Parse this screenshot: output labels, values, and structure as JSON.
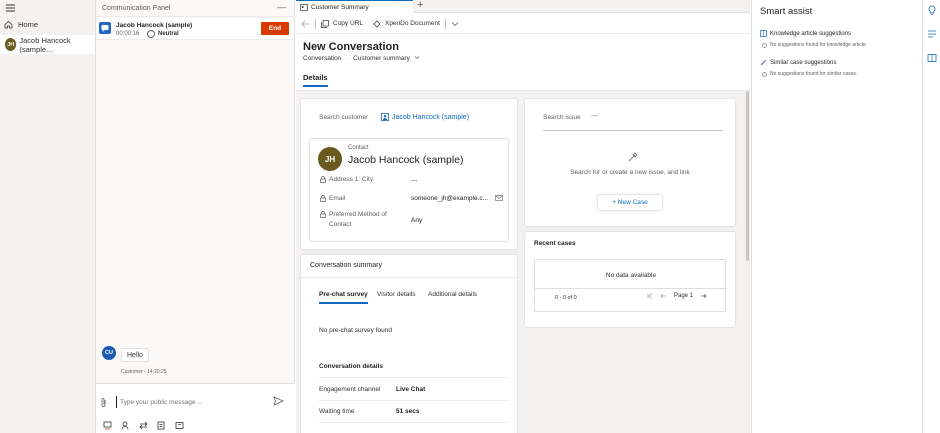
{
  "nav": {
    "home_label": "Home",
    "session_initials": "JH",
    "session_label": "Jacob Hancock (sample..."
  },
  "comm_panel": {
    "title": "Communication Panel",
    "minimize_glyph": "—",
    "session": {
      "name": "Jacob Hancock (sample)",
      "timer": "00:00:16",
      "sentiment": "Neutral",
      "end_label": "End"
    },
    "message": {
      "sender_initials": "CU",
      "text": "Hello",
      "meta": "Customer - 14:20:25"
    },
    "compose_placeholder": "Type your public message ..."
  },
  "tabs": {
    "active_tab": "Customer Summary",
    "add_glyph": "+"
  },
  "commands": {
    "copy_url": "Copy URL",
    "xperido": "XperiDo Document"
  },
  "page": {
    "title": "New Conversation",
    "breadcrumb_entity": "Conversation",
    "breadcrumb_separator": "·",
    "breadcrumb_form": "Customer summary",
    "details_tab": "Details"
  },
  "customer": {
    "search_label": "Search customer",
    "selected": "Jacob Hancock (sample)",
    "initials": "JH",
    "type": "Contact",
    "name": "Jacob Hancock (sample)",
    "fields": [
      {
        "label": "Address 1: City",
        "value": "---"
      },
      {
        "label": "Email",
        "value": "someone_jh@example.c..."
      },
      {
        "label": "Preferred Method of",
        "label2": "Contact",
        "value": "Any"
      }
    ]
  },
  "conversation_summary": {
    "title": "Conversation summary",
    "subtabs": [
      "Pre-chat survey",
      "Visitor details",
      "Additional details"
    ],
    "empty_survey": "No pre-chat survey found",
    "details_title": "Conversation details",
    "details": [
      {
        "label": "Engagement channel",
        "value": "Live Chat"
      },
      {
        "label": "Waiting time",
        "value": "51 secs"
      }
    ]
  },
  "issue": {
    "search_label": "Search issue",
    "value": "---",
    "hint": "Search for or create a new issue, and link",
    "new_case_label": "+ New Case"
  },
  "recent_cases": {
    "title": "Recent cases",
    "empty": "No data available",
    "count": "0 - 0 of 0",
    "page_label": "Page 1"
  },
  "smart_assist": {
    "title": "Smart assist",
    "sections": [
      {
        "title": "Knowledge article suggestions",
        "empty": "No suggestions found for knowledge article."
      },
      {
        "title": "Similar case suggestions",
        "empty": "No suggestions found for similar cases."
      }
    ]
  },
  "icons": {
    "hamburger": "hamburger-icon",
    "home": "home-icon",
    "chat": "chat-icon",
    "attach": "paperclip-icon",
    "send": "send-icon",
    "copy": "copy-icon",
    "document": "document-icon",
    "contact_card": "contact-card-icon",
    "lock": "lock-icon",
    "wand": "wand-icon",
    "lightbulb": "lightbulb-icon",
    "book": "book-icon"
  },
  "colors": {
    "accent": "#0f6cbd",
    "end_button": "#d83b01",
    "avatar_jh": "#6b5a1e",
    "avatar_cu": "#1e5cb3"
  }
}
